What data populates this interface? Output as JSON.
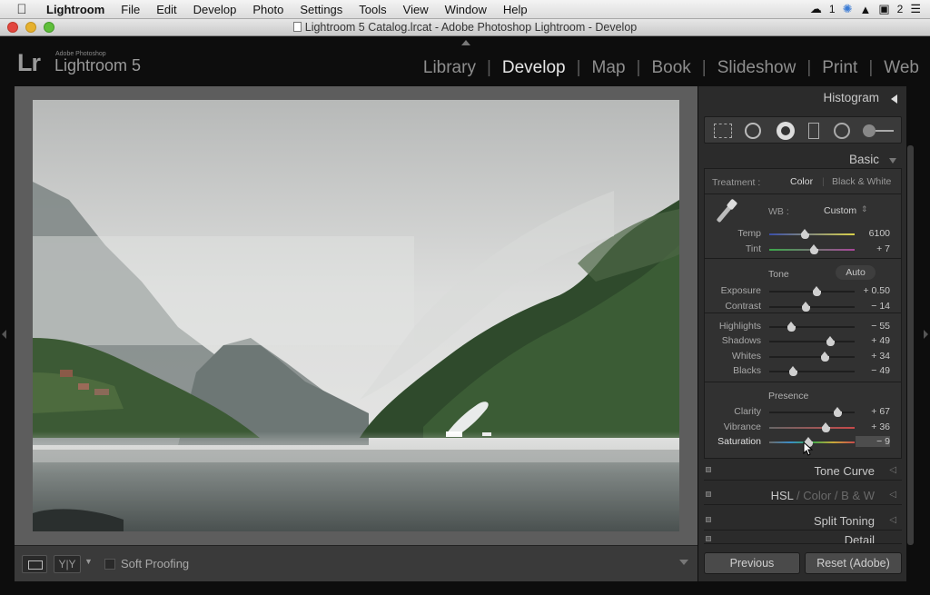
{
  "menubar": {
    "items": [
      "Lightroom",
      "File",
      "Edit",
      "Develop",
      "Photo",
      "Settings",
      "Tools",
      "View",
      "Window",
      "Help"
    ],
    "status": {
      "badge1": "1",
      "badge2": "2"
    }
  },
  "window": {
    "title": "Lightroom 5 Catalog.lrcat - Adobe Photoshop Lightroom - Develop"
  },
  "header": {
    "logo": "Lr",
    "subtitle": "Adobe Photoshop",
    "app_name": "Lightroom 5",
    "modules": [
      "Library",
      "Develop",
      "Map",
      "Book",
      "Slideshow",
      "Print",
      "Web"
    ],
    "active_module": "Develop"
  },
  "toolbar": {
    "view_yy": "Y|Y",
    "soft_proofing": "Soft Proofing"
  },
  "panel": {
    "histogram": "Histogram",
    "basic": "Basic",
    "treatment": {
      "label": "Treatment :",
      "color": "Color",
      "bw": "Black & White"
    },
    "wb": {
      "label": "WB :",
      "value": "Custom"
    },
    "tone_title": "Tone",
    "auto": "Auto",
    "presence_title": "Presence",
    "sliders": [
      {
        "name": "Temp",
        "value": "6100",
        "pos": 0.42
      },
      {
        "name": "Tint",
        "value": "+ 7",
        "pos": 0.52
      },
      {
        "name": "Exposure",
        "value": "+ 0.50",
        "pos": 0.55
      },
      {
        "name": "Contrast",
        "value": "− 14",
        "pos": 0.43
      },
      {
        "name": "Highlights",
        "value": "− 55",
        "pos": 0.25
      },
      {
        "name": "Shadows",
        "value": "+ 49",
        "pos": 0.71
      },
      {
        "name": "Whites",
        "value": "+ 34",
        "pos": 0.65
      },
      {
        "name": "Blacks",
        "value": "− 49",
        "pos": 0.28
      },
      {
        "name": "Clarity",
        "value": "+ 67",
        "pos": 0.8
      },
      {
        "name": "Vibrance",
        "value": "+ 36",
        "pos": 0.66
      },
      {
        "name": "Saturation",
        "value": "− 9",
        "pos": 0.46
      }
    ],
    "tone_curve": "Tone Curve",
    "hsl": {
      "a": "HSL",
      "b": "Color",
      "c": "B & W"
    },
    "split_toning": "Split Toning",
    "detail": "Detail",
    "previous": "Previous",
    "reset": "Reset (Adobe)"
  },
  "colors": {
    "active_text": "#e6e6e6",
    "inactive_text": "#8e8e8e",
    "panel_bg": "#2b2b2b"
  }
}
